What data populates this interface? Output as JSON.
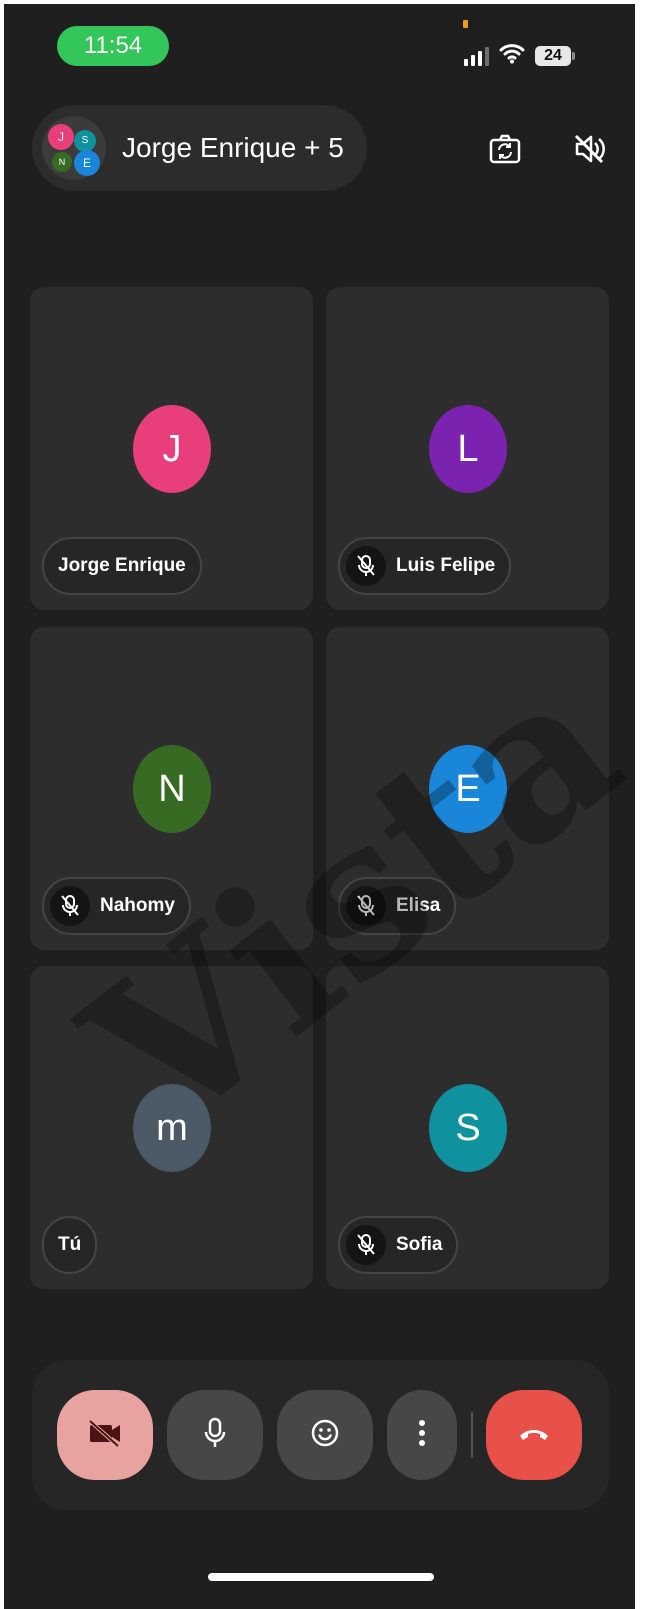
{
  "status_bar": {
    "time": "11:54",
    "battery": "24"
  },
  "header": {
    "title": "Jorge Enrique + 5",
    "group_avatar_letters": [
      "J",
      "S",
      "N",
      "E"
    ]
  },
  "participants": [
    {
      "name": "Jorge Enrique",
      "initial": "J",
      "color": "#e83e7c",
      "muted": false
    },
    {
      "name": "Luis Felipe",
      "initial": "L",
      "color": "#7b22b0",
      "muted": true
    },
    {
      "name": "Nahomy",
      "initial": "N",
      "color": "#376b24",
      "muted": true
    },
    {
      "name": "Elisa",
      "initial": "E",
      "color": "#1a86d9",
      "muted": true
    },
    {
      "name": "Tú",
      "initial": "m",
      "color": "#4b5a66",
      "muted": false
    },
    {
      "name": "Sofia",
      "initial": "S",
      "color": "#10929e",
      "muted": true
    }
  ],
  "controls": {
    "camera_off_color": "#e8a3a0",
    "button_color": "#474747",
    "end_call_color": "#e8504a"
  },
  "watermark": "Vista"
}
